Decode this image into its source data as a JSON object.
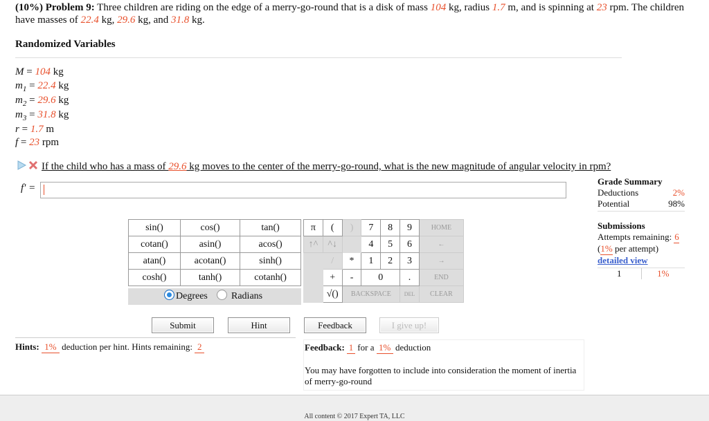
{
  "problem": {
    "header": "(10%) Problem 9:",
    "t1": " Three children are riding on the edge of a merry-go-round that is a disk of mass ",
    "mass": "104",
    "t2": " kg, radius ",
    "radius": "1.7",
    "t3": " m, and is spinning at ",
    "rpm": "23",
    "t4": " rpm. The children have masses of ",
    "m1": "22.4",
    "t5": " kg, ",
    "m2": "29.6",
    "t6": " kg, and ",
    "m3": "31.8",
    "t7": " kg."
  },
  "randomized": {
    "title": "Randomized Variables",
    "vars": [
      {
        "sym": "M",
        "sub": "",
        "val": "104",
        "unit": " kg"
      },
      {
        "sym": "m",
        "sub": "1",
        "val": "22.4",
        "unit": " kg"
      },
      {
        "sym": "m",
        "sub": "2",
        "val": "29.6",
        "unit": " kg"
      },
      {
        "sym": "m",
        "sub": "3",
        "val": "31.8",
        "unit": " kg"
      },
      {
        "sym": "r",
        "sub": "",
        "val": "1.7",
        "unit": " m"
      },
      {
        "sym": "f",
        "sub": "",
        "val": "23",
        "unit": " rpm"
      }
    ],
    "eq": " = "
  },
  "question": {
    "t1": "If the child who has a mass of ",
    "mass": "29.6",
    "t2": " kg moves to the center of the merry-go-round, what is the new magnitude of angular velocity in rpm?"
  },
  "answer": {
    "label": "f' = "
  },
  "grade": {
    "title": "Grade Summary",
    "deductions_label": "Deductions",
    "deductions_value": "2%",
    "potential_label": "Potential",
    "potential_value": "98%"
  },
  "submissions": {
    "title": "Submissions",
    "attempts_label": "Attempts remaining: ",
    "attempts_value": "6",
    "per_open": "(",
    "per_value": "1%",
    "per_rest": " per attempt)",
    "detailed": "detailed view",
    "row_num": "1",
    "row_pct": "1%"
  },
  "calc": {
    "funcs": [
      [
        "sin()",
        "cos()",
        "tan()"
      ],
      [
        "cotan()",
        "asin()",
        "acos()"
      ],
      [
        "atan()",
        "acotan()",
        "sinh()"
      ],
      [
        "cosh()",
        "tanh()",
        "cotanh()"
      ]
    ],
    "degrees": "Degrees",
    "radians": "Radians",
    "pi": "π",
    "lparen": "(",
    "rparen": ")",
    "up": "↑^",
    "down": "^↓",
    "star": "*",
    "slash": "/",
    "plus": "+",
    "minus": "-",
    "sqrt": "√()",
    "digits": [
      "7",
      "8",
      "9",
      "4",
      "5",
      "6",
      "1",
      "2",
      "3",
      "0"
    ],
    "dot": ".",
    "home": "HOME",
    "back_arrow": "←",
    "fwd_arrow": "→",
    "end": "END",
    "backspace": "BACKSPACE",
    "del": "DEL",
    "clear": "CLEAR"
  },
  "buttons": {
    "submit": "Submit",
    "hint": "Hint",
    "feedback": "Feedback",
    "giveup": "I give up!"
  },
  "hints": {
    "label": "Hints:",
    "pct": "1%",
    "text": " deduction per hint. Hints remaining: ",
    "remaining": "2"
  },
  "feedback": {
    "label": "Feedback:",
    "count": "1",
    "for_a": " for a ",
    "pct": "1%",
    "deduction": " deduction",
    "message": "You may have forgotten to include into consideration the moment of inertia of merry-go-round"
  },
  "footer": "All content © 2017 Expert TA, LLC",
  "colors": {
    "accent": "#e8502c",
    "link": "#3a5fcd",
    "radio": "#2b8ae0"
  }
}
